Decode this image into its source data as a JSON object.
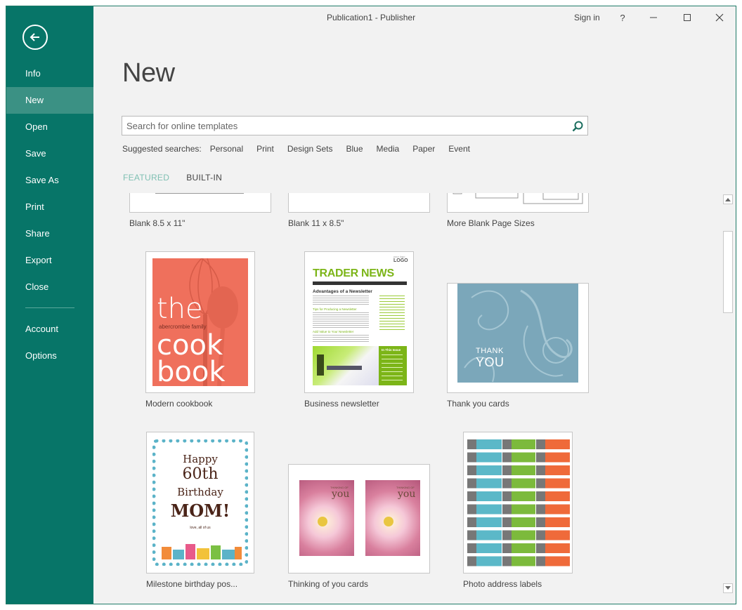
{
  "window": {
    "title": "Publication1 - Publisher",
    "sign_in": "Sign in",
    "help": "?"
  },
  "sidebar": {
    "items": [
      {
        "label": "Info"
      },
      {
        "label": "New"
      },
      {
        "label": "Open"
      },
      {
        "label": "Save"
      },
      {
        "label": "Save As"
      },
      {
        "label": "Print"
      },
      {
        "label": "Share"
      },
      {
        "label": "Export"
      },
      {
        "label": "Close"
      },
      {
        "label": "Account"
      },
      {
        "label": "Options"
      }
    ]
  },
  "page": {
    "title": "New"
  },
  "search": {
    "placeholder": "Search for online templates"
  },
  "suggested": {
    "label": "Suggested searches:",
    "items": [
      "Personal",
      "Print",
      "Design Sets",
      "Blue",
      "Media",
      "Paper",
      "Event"
    ]
  },
  "tabs": [
    {
      "label": "FEATURED"
    },
    {
      "label": "BUILT-IN"
    }
  ],
  "templates": [
    {
      "caption": "Blank 8.5 x 11\""
    },
    {
      "caption": "Blank 11 x 8.5\""
    },
    {
      "caption": "More Blank Page Sizes"
    },
    {
      "caption": "Modern cookbook",
      "art": {
        "line1": "the",
        "small": "abercrombie family",
        "line2": "cook",
        "line3": "book"
      }
    },
    {
      "caption": "Business newsletter",
      "art": {
        "logo_small": "your logo",
        "logo": "LOGO",
        "masthead": "TRADER NEWS",
        "headline": "Advantages of a Newsletter",
        "sub1": "Tips for Producing a Newsletter",
        "sub2": "Add Value to Your Newsletter",
        "inbox": "In This Issue"
      }
    },
    {
      "caption": "Thank you cards",
      "art": {
        "line1": "THANK",
        "line2": "YOU"
      }
    },
    {
      "caption": "Milestone birthday pos...",
      "art": {
        "line1": "Happy",
        "line2": "60th",
        "line3": "Birthday",
        "line4": "MOM!",
        "sign": "love, all of us"
      }
    },
    {
      "caption": "Thinking of you cards",
      "art": {
        "small": "THINKING OF",
        "big": "you"
      }
    },
    {
      "caption": "Photo address labels"
    }
  ],
  "colors": {
    "sidebar": "#077568",
    "sidebar_active": "#3b9184",
    "tab_active": "#7fc0b3"
  }
}
